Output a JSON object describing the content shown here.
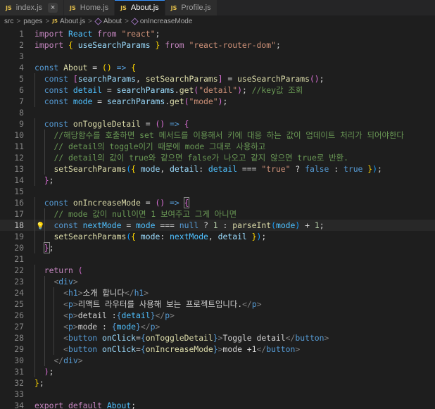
{
  "tabs": [
    {
      "name": "index.js",
      "icon": "js-file-icon",
      "close": "×",
      "active": false
    },
    {
      "name": "Home.js",
      "icon": "js-file-icon",
      "close": "",
      "active": false
    },
    {
      "name": "About.js",
      "icon": "js-file-icon",
      "close": "",
      "active": true
    },
    {
      "name": "Profile.js",
      "icon": "js-file-icon",
      "close": "",
      "active": false
    }
  ],
  "breadcrumb": {
    "items": [
      "src",
      "pages",
      "About.js",
      "About",
      "onIncreaseMode"
    ],
    "separator": ">",
    "js_badge": "JS"
  },
  "colors": {
    "background": "#1e1e1e",
    "keyword": "#c586c0",
    "storage": "#569cd6",
    "function": "#dcdcaa",
    "variable": "#4fc1ff",
    "property": "#9cdcfe",
    "string": "#ce9178",
    "comment": "#6a9955",
    "accent": "#3794ff"
  },
  "editor": {
    "current_line": 18,
    "lightbulb_line": 18,
    "line_numbers": [
      "1",
      "2",
      "3",
      "4",
      "5",
      "6",
      "7",
      "8",
      "9",
      "10",
      "11",
      "12",
      "13",
      "14",
      "15",
      "16",
      "17",
      "18",
      "19",
      "20",
      "21",
      "22",
      "23",
      "24",
      "25",
      "26",
      "27",
      "28",
      "29",
      "30",
      "31",
      "32",
      "33",
      "34"
    ],
    "lines": [
      [
        [
          "kw",
          "import"
        ],
        [
          "tx",
          " "
        ],
        [
          "var",
          "React"
        ],
        [
          "tx",
          " "
        ],
        [
          "kw",
          "from"
        ],
        [
          "tx",
          " "
        ],
        [
          "str",
          "\"react\""
        ],
        [
          "tx",
          ";"
        ]
      ],
      [
        [
          "kw",
          "import"
        ],
        [
          "tx",
          " "
        ],
        [
          "br1",
          "{"
        ],
        [
          "tx",
          " "
        ],
        [
          "pr",
          "useSearchParams"
        ],
        [
          "tx",
          " "
        ],
        [
          "br1",
          "}"
        ],
        [
          "tx",
          " "
        ],
        [
          "kw",
          "from"
        ],
        [
          "tx",
          " "
        ],
        [
          "str",
          "\"react-router-dom\""
        ],
        [
          "tx",
          ";"
        ]
      ],
      [],
      [
        [
          "st",
          "const"
        ],
        [
          "tx",
          " "
        ],
        [
          "fn",
          "About"
        ],
        [
          "tx",
          " = "
        ],
        [
          "br1",
          "()"
        ],
        [
          "tx",
          " "
        ],
        [
          "st",
          "=>"
        ],
        [
          "tx",
          " "
        ],
        [
          "br1",
          "{"
        ]
      ],
      [
        [
          "tx",
          "  "
        ],
        [
          "st",
          "const"
        ],
        [
          "tx",
          " "
        ],
        [
          "br2",
          "["
        ],
        [
          "pr",
          "searchParams"
        ],
        [
          "tx",
          ", "
        ],
        [
          "fn",
          "setSearchParams"
        ],
        [
          "br2",
          "]"
        ],
        [
          "tx",
          " = "
        ],
        [
          "fn",
          "useSearchParams"
        ],
        [
          "br2",
          "()"
        ],
        [
          "tx",
          ";"
        ]
      ],
      [
        [
          "tx",
          "  "
        ],
        [
          "st",
          "const"
        ],
        [
          "tx",
          " "
        ],
        [
          "var",
          "detail"
        ],
        [
          "tx",
          " = "
        ],
        [
          "pr",
          "searchParams"
        ],
        [
          "tx",
          "."
        ],
        [
          "fn",
          "get"
        ],
        [
          "br2",
          "("
        ],
        [
          "str",
          "\"detail\""
        ],
        [
          "br2",
          ")"
        ],
        [
          "tx",
          "; "
        ],
        [
          "cm",
          "//key값 조회"
        ]
      ],
      [
        [
          "tx",
          "  "
        ],
        [
          "st",
          "const"
        ],
        [
          "tx",
          " "
        ],
        [
          "var",
          "mode"
        ],
        [
          "tx",
          " = "
        ],
        [
          "pr",
          "searchParams"
        ],
        [
          "tx",
          "."
        ],
        [
          "fn",
          "get"
        ],
        [
          "br2",
          "("
        ],
        [
          "str",
          "\"mode\""
        ],
        [
          "br2",
          ")"
        ],
        [
          "tx",
          ";"
        ]
      ],
      [],
      [
        [
          "tx",
          "  "
        ],
        [
          "st",
          "const"
        ],
        [
          "tx",
          " "
        ],
        [
          "fn",
          "onToggleDetail"
        ],
        [
          "tx",
          " = "
        ],
        [
          "br2",
          "()"
        ],
        [
          "tx",
          " "
        ],
        [
          "st",
          "=>"
        ],
        [
          "tx",
          " "
        ],
        [
          "br2",
          "{"
        ]
      ],
      [
        [
          "tx",
          "    "
        ],
        [
          "cm",
          "//해당함수를 호출하면 set 메서드를 이용해서 키에 대응 하는 값이 업데이트 처리가 되어야한다"
        ]
      ],
      [
        [
          "tx",
          "    "
        ],
        [
          "cm",
          "// detail의 toggle이기 때문에 mode 그대로 사용하고"
        ]
      ],
      [
        [
          "tx",
          "    "
        ],
        [
          "cm",
          "// detail의 값이 true와 같으면 false가 나오고 같지 않으면 true로 반환."
        ]
      ],
      [
        [
          "tx",
          "    "
        ],
        [
          "fn",
          "setSearchParams"
        ],
        [
          "br3",
          "("
        ],
        [
          "br1",
          "{"
        ],
        [
          "tx",
          " "
        ],
        [
          "pr",
          "mode"
        ],
        [
          "tx",
          ", "
        ],
        [
          "pr",
          "detail"
        ],
        [
          "tx",
          ": "
        ],
        [
          "var",
          "detail"
        ],
        [
          "tx",
          " === "
        ],
        [
          "str",
          "\"true\""
        ],
        [
          "tx",
          " ? "
        ],
        [
          "st",
          "false"
        ],
        [
          "tx",
          " : "
        ],
        [
          "st",
          "true"
        ],
        [
          "tx",
          " "
        ],
        [
          "br1",
          "}"
        ],
        [
          "br3",
          ")"
        ],
        [
          "tx",
          ";"
        ]
      ],
      [
        [
          "tx",
          "  "
        ],
        [
          "br2",
          "}"
        ],
        [
          "tx",
          ";"
        ]
      ],
      [],
      [
        [
          "tx",
          "  "
        ],
        [
          "st",
          "const"
        ],
        [
          "tx",
          " "
        ],
        [
          "fn",
          "onIncreaseMode"
        ],
        [
          "tx",
          " = "
        ],
        [
          "br2",
          "()"
        ],
        [
          "tx",
          " "
        ],
        [
          "st",
          "=>"
        ],
        [
          "tx",
          " "
        ],
        [
          "br2 box",
          "{"
        ]
      ],
      [
        [
          "tx",
          "    "
        ],
        [
          "cm",
          "// mode 값이 null이면 1 보여주고 그게 아니면"
        ]
      ],
      [
        [
          "tx",
          "    "
        ],
        [
          "st",
          "const"
        ],
        [
          "tx",
          " "
        ],
        [
          "var",
          "nextMode"
        ],
        [
          "tx",
          " = "
        ],
        [
          "var",
          "mode"
        ],
        [
          "tx",
          " === "
        ],
        [
          "st",
          "null"
        ],
        [
          "tx",
          " ? "
        ],
        [
          "num",
          "1"
        ],
        [
          "tx",
          " : "
        ],
        [
          "fn",
          "parseInt"
        ],
        [
          "br3",
          "("
        ],
        [
          "var",
          "mode"
        ],
        [
          "br3",
          ")"
        ],
        [
          "tx",
          " + "
        ],
        [
          "num",
          "1"
        ],
        [
          "tx",
          ";"
        ]
      ],
      [
        [
          "tx",
          "    "
        ],
        [
          "fn",
          "setSearchParams"
        ],
        [
          "br3",
          "("
        ],
        [
          "br1",
          "{"
        ],
        [
          "tx",
          " "
        ],
        [
          "pr",
          "mode"
        ],
        [
          "tx",
          ": "
        ],
        [
          "var",
          "nextMode"
        ],
        [
          "tx",
          ", "
        ],
        [
          "pr",
          "detail"
        ],
        [
          "tx",
          " "
        ],
        [
          "br1",
          "}"
        ],
        [
          "br3",
          ")"
        ],
        [
          "tx",
          ";"
        ]
      ],
      [
        [
          "tx",
          "  "
        ],
        [
          "br2 box",
          "}"
        ],
        [
          "tx",
          ";"
        ]
      ],
      [],
      [
        [
          "tx",
          "  "
        ],
        [
          "kw",
          "return"
        ],
        [
          "tx",
          " "
        ],
        [
          "br2",
          "("
        ]
      ],
      [
        [
          "tx",
          "    "
        ],
        [
          "tb",
          "<"
        ],
        [
          "tg",
          "div"
        ],
        [
          "tb",
          ">"
        ]
      ],
      [
        [
          "tx",
          "      "
        ],
        [
          "tb",
          "<"
        ],
        [
          "tg",
          "h1"
        ],
        [
          "tb",
          ">"
        ],
        [
          "tx",
          "소개 합니다"
        ],
        [
          "tb",
          "</"
        ],
        [
          "tg",
          "h1"
        ],
        [
          "tb",
          ">"
        ]
      ],
      [
        [
          "tx",
          "      "
        ],
        [
          "tb",
          "<"
        ],
        [
          "tg",
          "p"
        ],
        [
          "tb",
          ">"
        ],
        [
          "tx",
          "리액트 라우터를 사용해 보는 프로젝트입니다."
        ],
        [
          "tb",
          "</"
        ],
        [
          "tg",
          "p"
        ],
        [
          "tb",
          ">"
        ]
      ],
      [
        [
          "tx",
          "      "
        ],
        [
          "tb",
          "<"
        ],
        [
          "tg",
          "p"
        ],
        [
          "tb",
          ">"
        ],
        [
          "tx",
          "detail :"
        ],
        [
          "st",
          "{"
        ],
        [
          "var",
          "detail"
        ],
        [
          "st",
          "}"
        ],
        [
          "tb",
          "</"
        ],
        [
          "tg",
          "p"
        ],
        [
          "tb",
          ">"
        ]
      ],
      [
        [
          "tx",
          "      "
        ],
        [
          "tb",
          "<"
        ],
        [
          "tg",
          "p"
        ],
        [
          "tb",
          ">"
        ],
        [
          "tx",
          "mode : "
        ],
        [
          "st",
          "{"
        ],
        [
          "var",
          "mode"
        ],
        [
          "st",
          "}"
        ],
        [
          "tb",
          "</"
        ],
        [
          "tg",
          "p"
        ],
        [
          "tb",
          ">"
        ]
      ],
      [
        [
          "tx",
          "      "
        ],
        [
          "tb",
          "<"
        ],
        [
          "tg",
          "button"
        ],
        [
          "tx",
          " "
        ],
        [
          "pr",
          "onClick"
        ],
        [
          "tx",
          "="
        ],
        [
          "st",
          "{"
        ],
        [
          "fn",
          "onToggleDetail"
        ],
        [
          "st",
          "}"
        ],
        [
          "tb",
          ">"
        ],
        [
          "tx",
          "Toggle detail"
        ],
        [
          "tb",
          "</"
        ],
        [
          "tg",
          "button"
        ],
        [
          "tb",
          ">"
        ]
      ],
      [
        [
          "tx",
          "      "
        ],
        [
          "tb",
          "<"
        ],
        [
          "tg",
          "button"
        ],
        [
          "tx",
          " "
        ],
        [
          "pr",
          "onClick"
        ],
        [
          "tx",
          "="
        ],
        [
          "st",
          "{"
        ],
        [
          "fn",
          "onIncreaseMode"
        ],
        [
          "st",
          "}"
        ],
        [
          "tb",
          ">"
        ],
        [
          "tx",
          "mode +1"
        ],
        [
          "tb",
          "</"
        ],
        [
          "tg",
          "button"
        ],
        [
          "tb",
          ">"
        ]
      ],
      [
        [
          "tx",
          "    "
        ],
        [
          "tb",
          "</"
        ],
        [
          "tg",
          "div"
        ],
        [
          "tb",
          ">"
        ]
      ],
      [
        [
          "tx",
          "  "
        ],
        [
          "br2",
          ")"
        ],
        [
          "tx",
          ";"
        ]
      ],
      [
        [
          "br1",
          "}"
        ],
        [
          "tx",
          ";"
        ]
      ],
      [],
      [
        [
          "kw",
          "export"
        ],
        [
          "tx",
          " "
        ],
        [
          "kw",
          "default"
        ],
        [
          "tx",
          " "
        ],
        [
          "var",
          "About"
        ],
        [
          "tx",
          ";"
        ]
      ]
    ]
  }
}
